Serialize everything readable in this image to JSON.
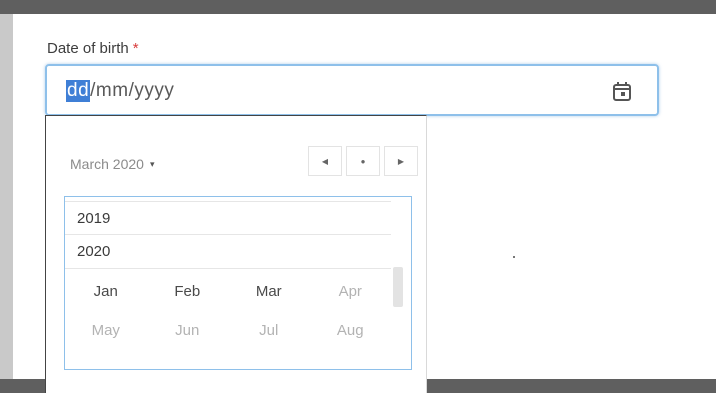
{
  "field": {
    "label": "Date of birth",
    "required_mark": "*",
    "segments": {
      "day": "dd",
      "sep1": "/",
      "month": "mm",
      "sep2": "/",
      "year": "yyyy"
    },
    "icon": "calendar-icon"
  },
  "picker": {
    "current": "March 2020",
    "caret": "▾",
    "nav": {
      "prev": "◀",
      "today": "●",
      "next": "▶"
    },
    "years": [
      "2019",
      "2020"
    ],
    "months": [
      {
        "label": "Jan",
        "state": "enabled"
      },
      {
        "label": "Feb",
        "state": "enabled"
      },
      {
        "label": "Mar",
        "state": "enabled"
      },
      {
        "label": "Apr",
        "state": "disabled"
      },
      {
        "label": "May",
        "state": "disabled"
      },
      {
        "label": "Jun",
        "state": "disabled"
      },
      {
        "label": "Jul",
        "state": "disabled"
      },
      {
        "label": "Aug",
        "state": "disabled"
      }
    ]
  },
  "colors": {
    "accent": "#3f7fd6",
    "focus_border": "#8ec0ea",
    "required": "#d83b3b"
  }
}
